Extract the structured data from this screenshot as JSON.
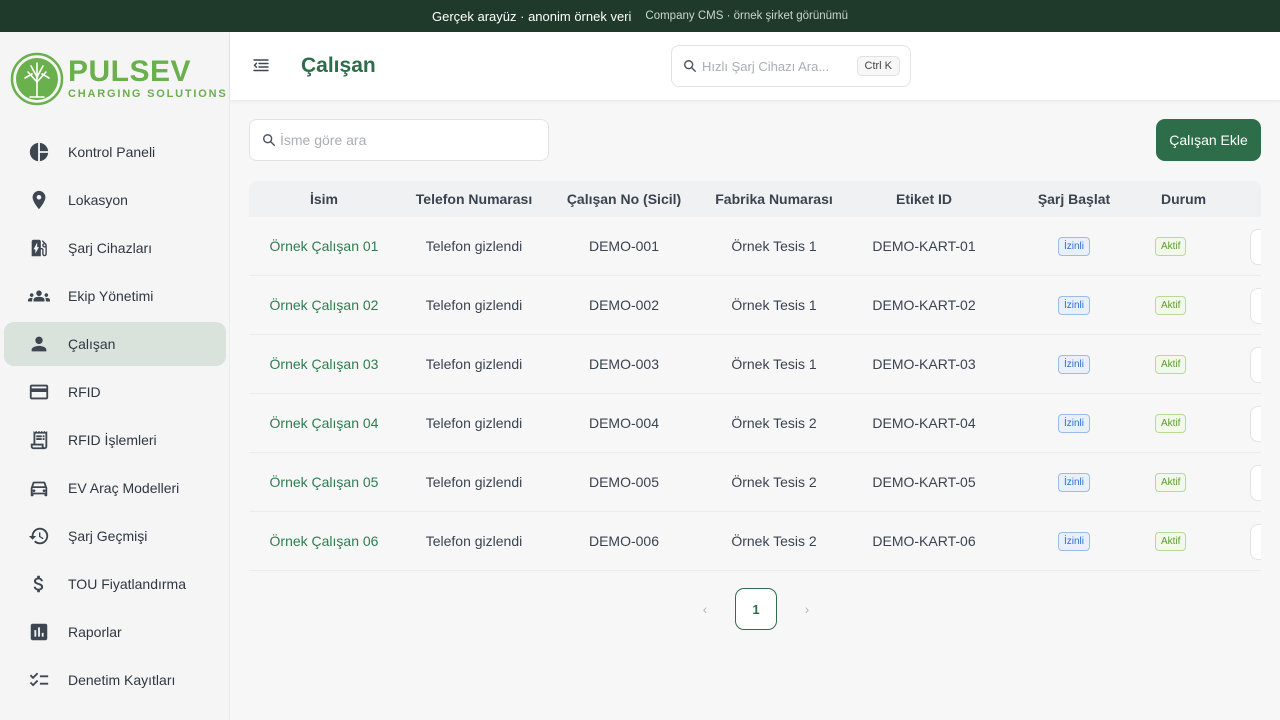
{
  "banner": {
    "main": "Gerçek arayüz · anonim örnek veri",
    "sub": "Company CMS · örnek şirket görünümü"
  },
  "brand": {
    "name": "PULSEV",
    "tagline": "CHARGING SOLUTIONS",
    "color": "#6ab04c"
  },
  "sidebar": {
    "items": [
      {
        "label": "Kontrol Paneli",
        "icon": "dashboard-icon"
      },
      {
        "label": "Lokasyon",
        "icon": "location-pin-icon"
      },
      {
        "label": "Şarj Cihazları",
        "icon": "ev-station-icon"
      },
      {
        "label": "Ekip Yönetimi",
        "icon": "team-icon"
      },
      {
        "label": "Çalışan",
        "icon": "person-icon",
        "active": true
      },
      {
        "label": "RFID",
        "icon": "card-icon"
      },
      {
        "label": "RFID İşlemleri",
        "icon": "receipt-icon"
      },
      {
        "label": "EV Araç Modelleri",
        "icon": "car-icon"
      },
      {
        "label": "Şarj Geçmişi",
        "icon": "history-icon"
      },
      {
        "label": "TOU Fiyatlandırma",
        "icon": "dollar-icon"
      },
      {
        "label": "Raporlar",
        "icon": "bar-chart-icon"
      },
      {
        "label": "Denetim Kayıtları",
        "icon": "checklist-icon"
      }
    ]
  },
  "header": {
    "title": "Çalışan",
    "quick_search_placeholder": "Hızlı Şarj Cihazı Ara...",
    "shortcut": "Ctrl K"
  },
  "toolbar": {
    "name_search_placeholder": "İsme göre ara",
    "add_button": "Çalışan Ekle"
  },
  "table": {
    "columns": [
      "İsim",
      "Telefon Numarası",
      "Çalışan No (Sicil)",
      "Fabrika Numarası",
      "Etiket ID",
      "Şarj Başlat",
      "Durum"
    ],
    "rows": [
      {
        "name": "Örnek Çalışan 01",
        "phone": "Telefon gizlendi",
        "emp_no": "DEMO-001",
        "factory": "Örnek Tesis 1",
        "tag": "DEMO-KART-01",
        "charge": "İzinli",
        "status": "Aktif"
      },
      {
        "name": "Örnek Çalışan 02",
        "phone": "Telefon gizlendi",
        "emp_no": "DEMO-002",
        "factory": "Örnek Tesis 1",
        "tag": "DEMO-KART-02",
        "charge": "İzinli",
        "status": "Aktif"
      },
      {
        "name": "Örnek Çalışan 03",
        "phone": "Telefon gizlendi",
        "emp_no": "DEMO-003",
        "factory": "Örnek Tesis 1",
        "tag": "DEMO-KART-03",
        "charge": "İzinli",
        "status": "Aktif"
      },
      {
        "name": "Örnek Çalışan 04",
        "phone": "Telefon gizlendi",
        "emp_no": "DEMO-004",
        "factory": "Örnek Tesis 2",
        "tag": "DEMO-KART-04",
        "charge": "İzinli",
        "status": "Aktif"
      },
      {
        "name": "Örnek Çalışan 05",
        "phone": "Telefon gizlendi",
        "emp_no": "DEMO-005",
        "factory": "Örnek Tesis 2",
        "tag": "DEMO-KART-05",
        "charge": "İzinli",
        "status": "Aktif"
      },
      {
        "name": "Örnek Çalışan 06",
        "phone": "Telefon gizlendi",
        "emp_no": "DEMO-006",
        "factory": "Örnek Tesis 2",
        "tag": "DEMO-KART-06",
        "charge": "İzinli",
        "status": "Aktif"
      }
    ]
  },
  "pagination": {
    "current": "1",
    "prev": "‹",
    "next": "›"
  },
  "colors": {
    "accent": "#2e6d4a",
    "topbar": "#1f3a2a",
    "active_nav": "#d9e3dc"
  }
}
